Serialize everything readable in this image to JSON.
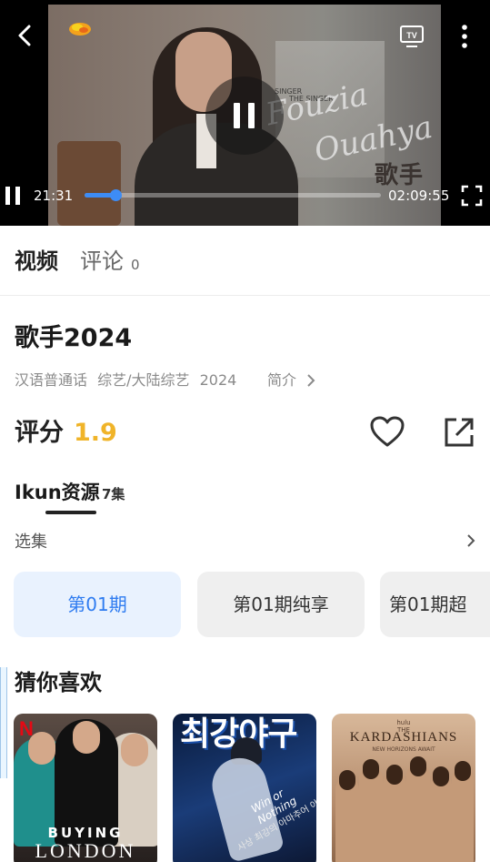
{
  "player": {
    "current_time": "21:31",
    "total_time": "02:09:55",
    "progress_fraction": 0.104,
    "overlay_script_line1": "Fouzia",
    "overlay_script_line2": "Ouahya",
    "overlay_show_logo": "歌手",
    "overlay_small_text_1": "SINGER",
    "overlay_small_text_2": "THE SINGER"
  },
  "tabs": [
    {
      "label": "视频"
    },
    {
      "label": "评论",
      "count": "0"
    }
  ],
  "show": {
    "title": "歌手2024",
    "language": "汉语普通话",
    "genre": "综艺/大陆综艺",
    "year": "2024",
    "intro_label": "简介"
  },
  "rating": {
    "label": "评分",
    "value": "1.9"
  },
  "source": {
    "name": "Ikun资源",
    "count": "7集"
  },
  "episodes": {
    "label": "选集",
    "items": [
      {
        "label": "第01期"
      },
      {
        "label": "第01期纯享"
      },
      {
        "label": "第01期超"
      }
    ]
  },
  "recommendations": {
    "title": "猜你喜欢",
    "items": [
      {
        "badge": "N",
        "caption_top": "BUYING",
        "caption_bottom": "LONDON"
      },
      {
        "headline": "최강야구",
        "tagline": "Win or Nothing",
        "subtext": "사상 최강의 아마추어 야구"
      },
      {
        "brand": "hulu",
        "the": "THE",
        "name": "KARDASHIANS",
        "sub": "NEW HORIZONS AWAIT"
      }
    ]
  },
  "colors": {
    "accent": "#3d8cf5",
    "rating": "#f0b429",
    "selected_episode_bg": "#e9f2fe",
    "selected_episode_text": "#2f7cf0"
  },
  "icons": {
    "back": "chevron-left-icon",
    "tv": "tv-cast-icon",
    "more": "more-vertical-icon",
    "pause": "pause-icon",
    "fullscreen": "fullscreen-icon",
    "favorite": "heart-icon",
    "share": "share-icon",
    "chevron": "chevron-right-icon"
  }
}
